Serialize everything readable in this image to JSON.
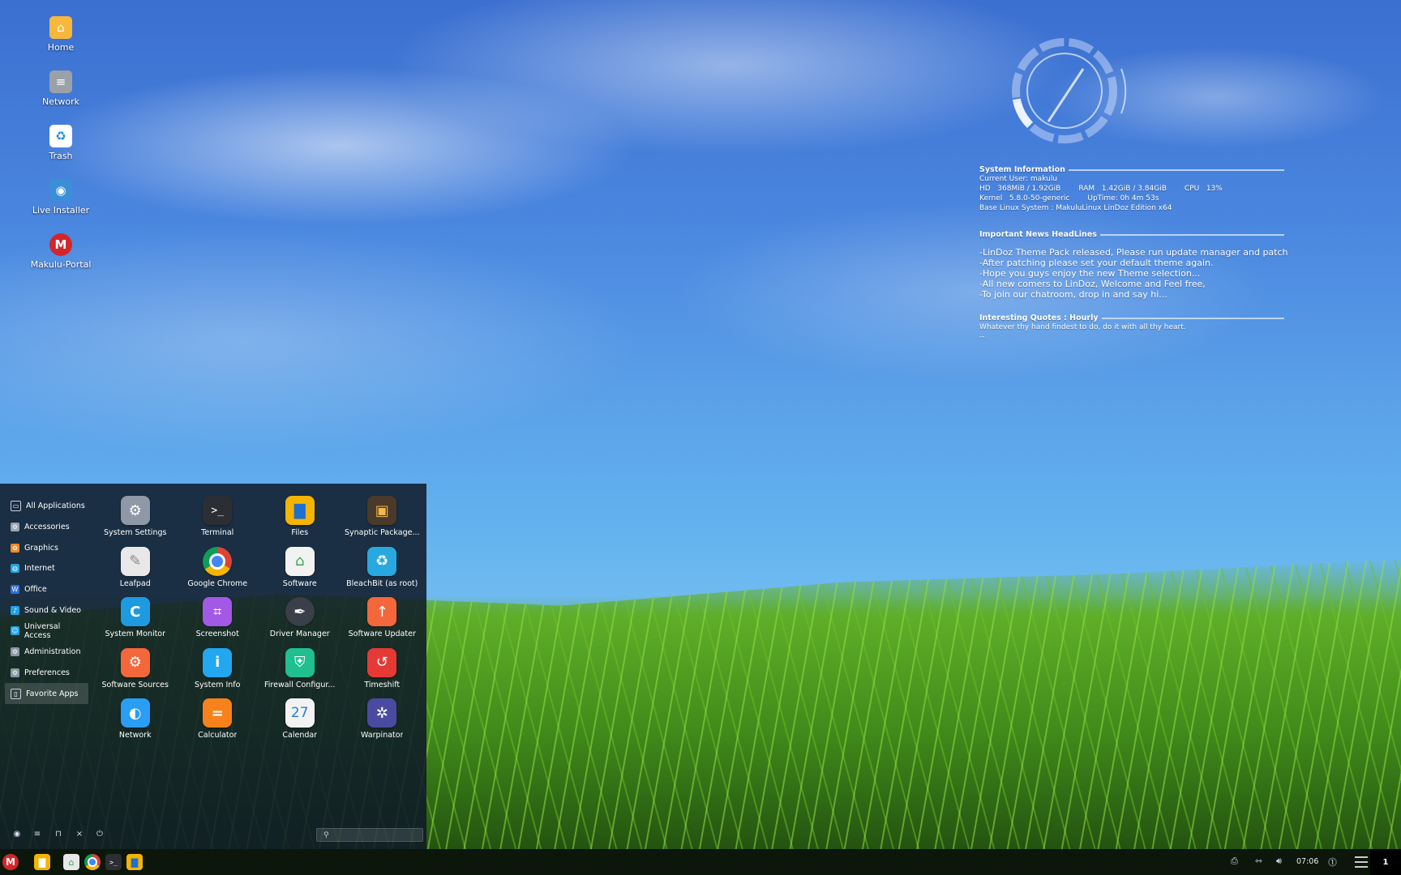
{
  "desktop": {
    "icons": [
      {
        "label": "Home",
        "icon": "home-folder-icon",
        "color": "#f6b73c"
      },
      {
        "label": "Network",
        "icon": "network-icon",
        "color": "#9aa2a8"
      },
      {
        "label": "Trash",
        "icon": "trash-icon",
        "color": "#ffffff"
      },
      {
        "label": "Live Installer",
        "icon": "installer-icon",
        "color": "#3a8fd8"
      },
      {
        "label": "Makulu-Portal",
        "icon": "makulu-logo-icon",
        "color": "#d3262b"
      }
    ]
  },
  "conky": {
    "system_header": "System Information",
    "current_user": "Current User: makulu",
    "hd_label": "HD",
    "hd_value": "368MiB / 1.92GiB",
    "ram_label": "RAM",
    "ram_value": "1.42GiB / 3.84GiB",
    "cpu_label": "CPU",
    "cpu_value": "13%",
    "kernel_label": "Kernel",
    "kernel_value": "5.8.0-50-generic",
    "uptime": "UpTime: 0h 4m 53s",
    "base_system": "Base Linux System :   MakuluLinux LinDoz Edition x64",
    "news_header": "Important News HeadLines",
    "news": [
      "-LinDoz Theme Pack released, Please run update manager and patch",
      "-After patching please set your default theme again.",
      "-Hope you guys enjoy the new Theme selection...",
      "-All new comers to LinDoz, Welcome and Feel free,",
      "-To join our chatroom, drop in and say hi..."
    ],
    "quotes_header": "Interesting Quotes : Hourly",
    "quote": "Whatever thy hand findest to do, do it with all thy heart.",
    "quote_author": "--",
    "cpu_gauge_fraction": 0.13
  },
  "menu": {
    "categories": [
      {
        "label": "All Applications",
        "icon": "monitor-icon",
        "color": "#2a3444"
      },
      {
        "label": "Accessories",
        "icon": "accessories-icon",
        "color": "#9aa4b0"
      },
      {
        "label": "Graphics",
        "icon": "graphics-icon",
        "color": "#f08a24"
      },
      {
        "label": "Internet",
        "icon": "internet-icon",
        "color": "#1fa3e8"
      },
      {
        "label": "Office",
        "icon": "office-icon",
        "color": "#2f6fd8"
      },
      {
        "label": "Sound & Video",
        "icon": "sound-video-icon",
        "color": "#1fa3e8"
      },
      {
        "label": "Universal Access",
        "icon": "universal-access-icon",
        "color": "#1fa3e8"
      },
      {
        "label": "Administration",
        "icon": "administration-icon",
        "color": "#8c97a4"
      },
      {
        "label": "Preferences",
        "icon": "preferences-icon",
        "color": "#8c97a4"
      },
      {
        "label": "Favorite Apps",
        "icon": "favorites-icon",
        "color": "#2a3444"
      }
    ],
    "apps": [
      {
        "label": "System Settings",
        "icon": "settings-gear-icon",
        "color": "#8e98a6",
        "glyph": "⚙"
      },
      {
        "label": "Terminal",
        "icon": "terminal-icon",
        "color": "#2b2f33",
        "glyph": ">_"
      },
      {
        "label": "Files",
        "icon": "files-folder-icon",
        "color": "#f4b400",
        "glyph": "▇"
      },
      {
        "label": "Synaptic Package...",
        "icon": "package-box-icon",
        "color": "#4a3a2a",
        "glyph": "▣"
      },
      {
        "label": "Leafpad",
        "icon": "notepad-icon",
        "color": "#e8e8e8",
        "glyph": "✎"
      },
      {
        "label": "Google Chrome",
        "icon": "chrome-icon",
        "color": "#db4437",
        "glyph": "●"
      },
      {
        "label": "Software",
        "icon": "software-bag-icon",
        "color": "#f2f2f2",
        "glyph": "⌂"
      },
      {
        "label": "BleachBit (as root)",
        "icon": "bleachbit-icon",
        "color": "#29a8e0",
        "glyph": "♻"
      },
      {
        "label": "System Monitor",
        "icon": "system-monitor-icon",
        "color": "#1e9be0",
        "glyph": "C"
      },
      {
        "label": "Screenshot",
        "icon": "screenshot-crop-icon",
        "color": "#a259e6",
        "glyph": "⌗"
      },
      {
        "label": "Driver Manager",
        "icon": "driver-manager-icon",
        "color": "#3a3f4a",
        "glyph": "✒"
      },
      {
        "label": "Software Updater",
        "icon": "software-updater-icon",
        "color": "#f4673a",
        "glyph": "↑"
      },
      {
        "label": "Software Sources",
        "icon": "software-sources-icon",
        "color": "#f4673a",
        "glyph": "⚙"
      },
      {
        "label": "System Info",
        "icon": "info-icon",
        "color": "#22a7f0",
        "glyph": "i"
      },
      {
        "label": "Firewall Configur...",
        "icon": "firewall-shield-icon",
        "color": "#1fbf8f",
        "glyph": "⛨"
      },
      {
        "label": "Timeshift",
        "icon": "timeshift-icon",
        "color": "#e53935",
        "glyph": "↺"
      },
      {
        "label": "Network",
        "icon": "network-globe-icon",
        "color": "#2a9df4",
        "glyph": "◐"
      },
      {
        "label": "Calculator",
        "icon": "calculator-icon",
        "color": "#f7821b",
        "glyph": "="
      },
      {
        "label": "Calendar",
        "icon": "calendar-icon",
        "color": "#f2f2f2",
        "glyph": "27"
      },
      {
        "label": "Warpinator",
        "icon": "warpinator-icon",
        "color": "#4a4aa0",
        "glyph": "✲"
      }
    ],
    "search_placeholder": ""
  },
  "taskbar": {
    "start_label": "M",
    "pinned": [
      {
        "icon": "files-folder-icon",
        "color": "#f4b400"
      },
      {
        "icon": "software-bag-icon",
        "color": "#e8e8e8"
      },
      {
        "icon": "chrome-icon",
        "color": "#db4437"
      },
      {
        "icon": "terminal-icon",
        "color": "#2b2f33"
      },
      {
        "icon": "files-folder-icon",
        "color": "#f4b400"
      }
    ],
    "clock": "07:06",
    "workspace": "1"
  }
}
